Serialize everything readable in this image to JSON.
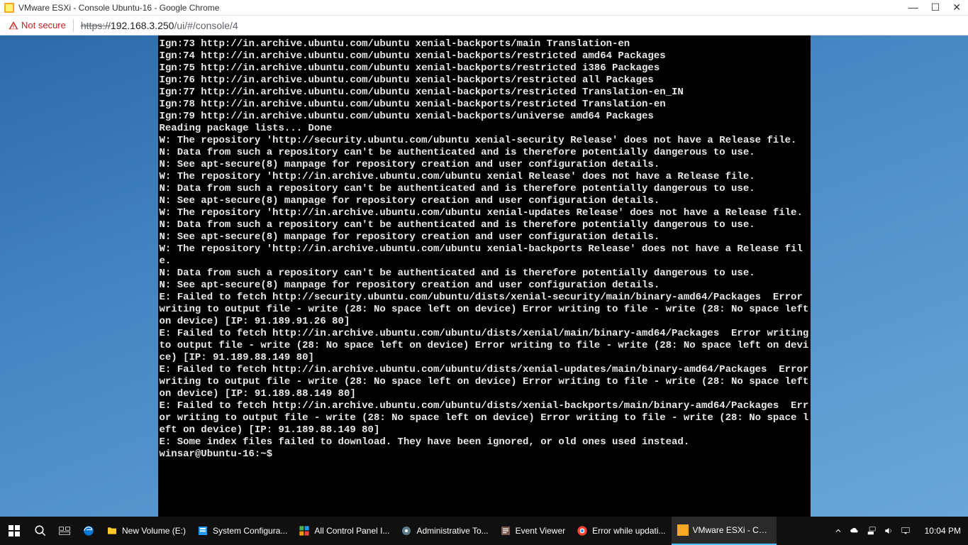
{
  "window": {
    "title": "VMware ESXi - Console Ubuntu-16 - Google Chrome"
  },
  "address": {
    "not_secure": "Not secure",
    "scheme": "https://",
    "host": "192.168.3.250",
    "path": "/ui/#/console/4"
  },
  "console_lines": [
    "Ign:73 http://in.archive.ubuntu.com/ubuntu xenial-backports/main Translation-en",
    "Ign:74 http://in.archive.ubuntu.com/ubuntu xenial-backports/restricted amd64 Packages",
    "Ign:75 http://in.archive.ubuntu.com/ubuntu xenial-backports/restricted i386 Packages",
    "Ign:76 http://in.archive.ubuntu.com/ubuntu xenial-backports/restricted all Packages",
    "Ign:77 http://in.archive.ubuntu.com/ubuntu xenial-backports/restricted Translation-en_IN",
    "Ign:78 http://in.archive.ubuntu.com/ubuntu xenial-backports/restricted Translation-en",
    "Ign:79 http://in.archive.ubuntu.com/ubuntu xenial-backports/universe amd64 Packages",
    "Reading package lists... Done",
    "W: The repository 'http://security.ubuntu.com/ubuntu xenial-security Release' does not have a Release file.",
    "N: Data from such a repository can't be authenticated and is therefore potentially dangerous to use.",
    "N: See apt-secure(8) manpage for repository creation and user configuration details.",
    "W: The repository 'http://in.archive.ubuntu.com/ubuntu xenial Release' does not have a Release file.",
    "N: Data from such a repository can't be authenticated and is therefore potentially dangerous to use.",
    "N: See apt-secure(8) manpage for repository creation and user configuration details.",
    "W: The repository 'http://in.archive.ubuntu.com/ubuntu xenial-updates Release' does not have a Release file.",
    "N: Data from such a repository can't be authenticated and is therefore potentially dangerous to use.",
    "N: See apt-secure(8) manpage for repository creation and user configuration details.",
    "W: The repository 'http://in.archive.ubuntu.com/ubuntu xenial-backports Release' does not have a Release file.",
    "N: Data from such a repository can't be authenticated and is therefore potentially dangerous to use.",
    "N: See apt-secure(8) manpage for repository creation and user configuration details.",
    "E: Failed to fetch http://security.ubuntu.com/ubuntu/dists/xenial-security/main/binary-amd64/Packages  Error writing to output file - write (28: No space left on device) Error writing to file - write (28: No space left on device) [IP: 91.189.91.26 80]",
    "E: Failed to fetch http://in.archive.ubuntu.com/ubuntu/dists/xenial/main/binary-amd64/Packages  Error writing to output file - write (28: No space left on device) Error writing to file - write (28: No space left on device) [IP: 91.189.88.149 80]",
    "E: Failed to fetch http://in.archive.ubuntu.com/ubuntu/dists/xenial-updates/main/binary-amd64/Packages  Error writing to output file - write (28: No space left on device) Error writing to file - write (28: No space left on device) [IP: 91.189.88.149 80]",
    "E: Failed to fetch http://in.archive.ubuntu.com/ubuntu/dists/xenial-backports/main/binary-amd64/Packages  Error writing to output file - write (28: No space left on device) Error writing to file - write (28: No space left on device) [IP: 91.189.88.149 80]",
    "E: Some index files failed to download. They have been ignored, or old ones used instead.",
    "winsar@Ubuntu-16:~$ "
  ],
  "taskbar": {
    "items": [
      {
        "label": "New Volume (E:)"
      },
      {
        "label": "System Configura..."
      },
      {
        "label": "All Control Panel I..."
      },
      {
        "label": "Administrative To..."
      },
      {
        "label": "Event Viewer"
      },
      {
        "label": "Error while updati..."
      },
      {
        "label": "VMware ESXi - Co..."
      }
    ],
    "clock": "10:04 PM"
  }
}
